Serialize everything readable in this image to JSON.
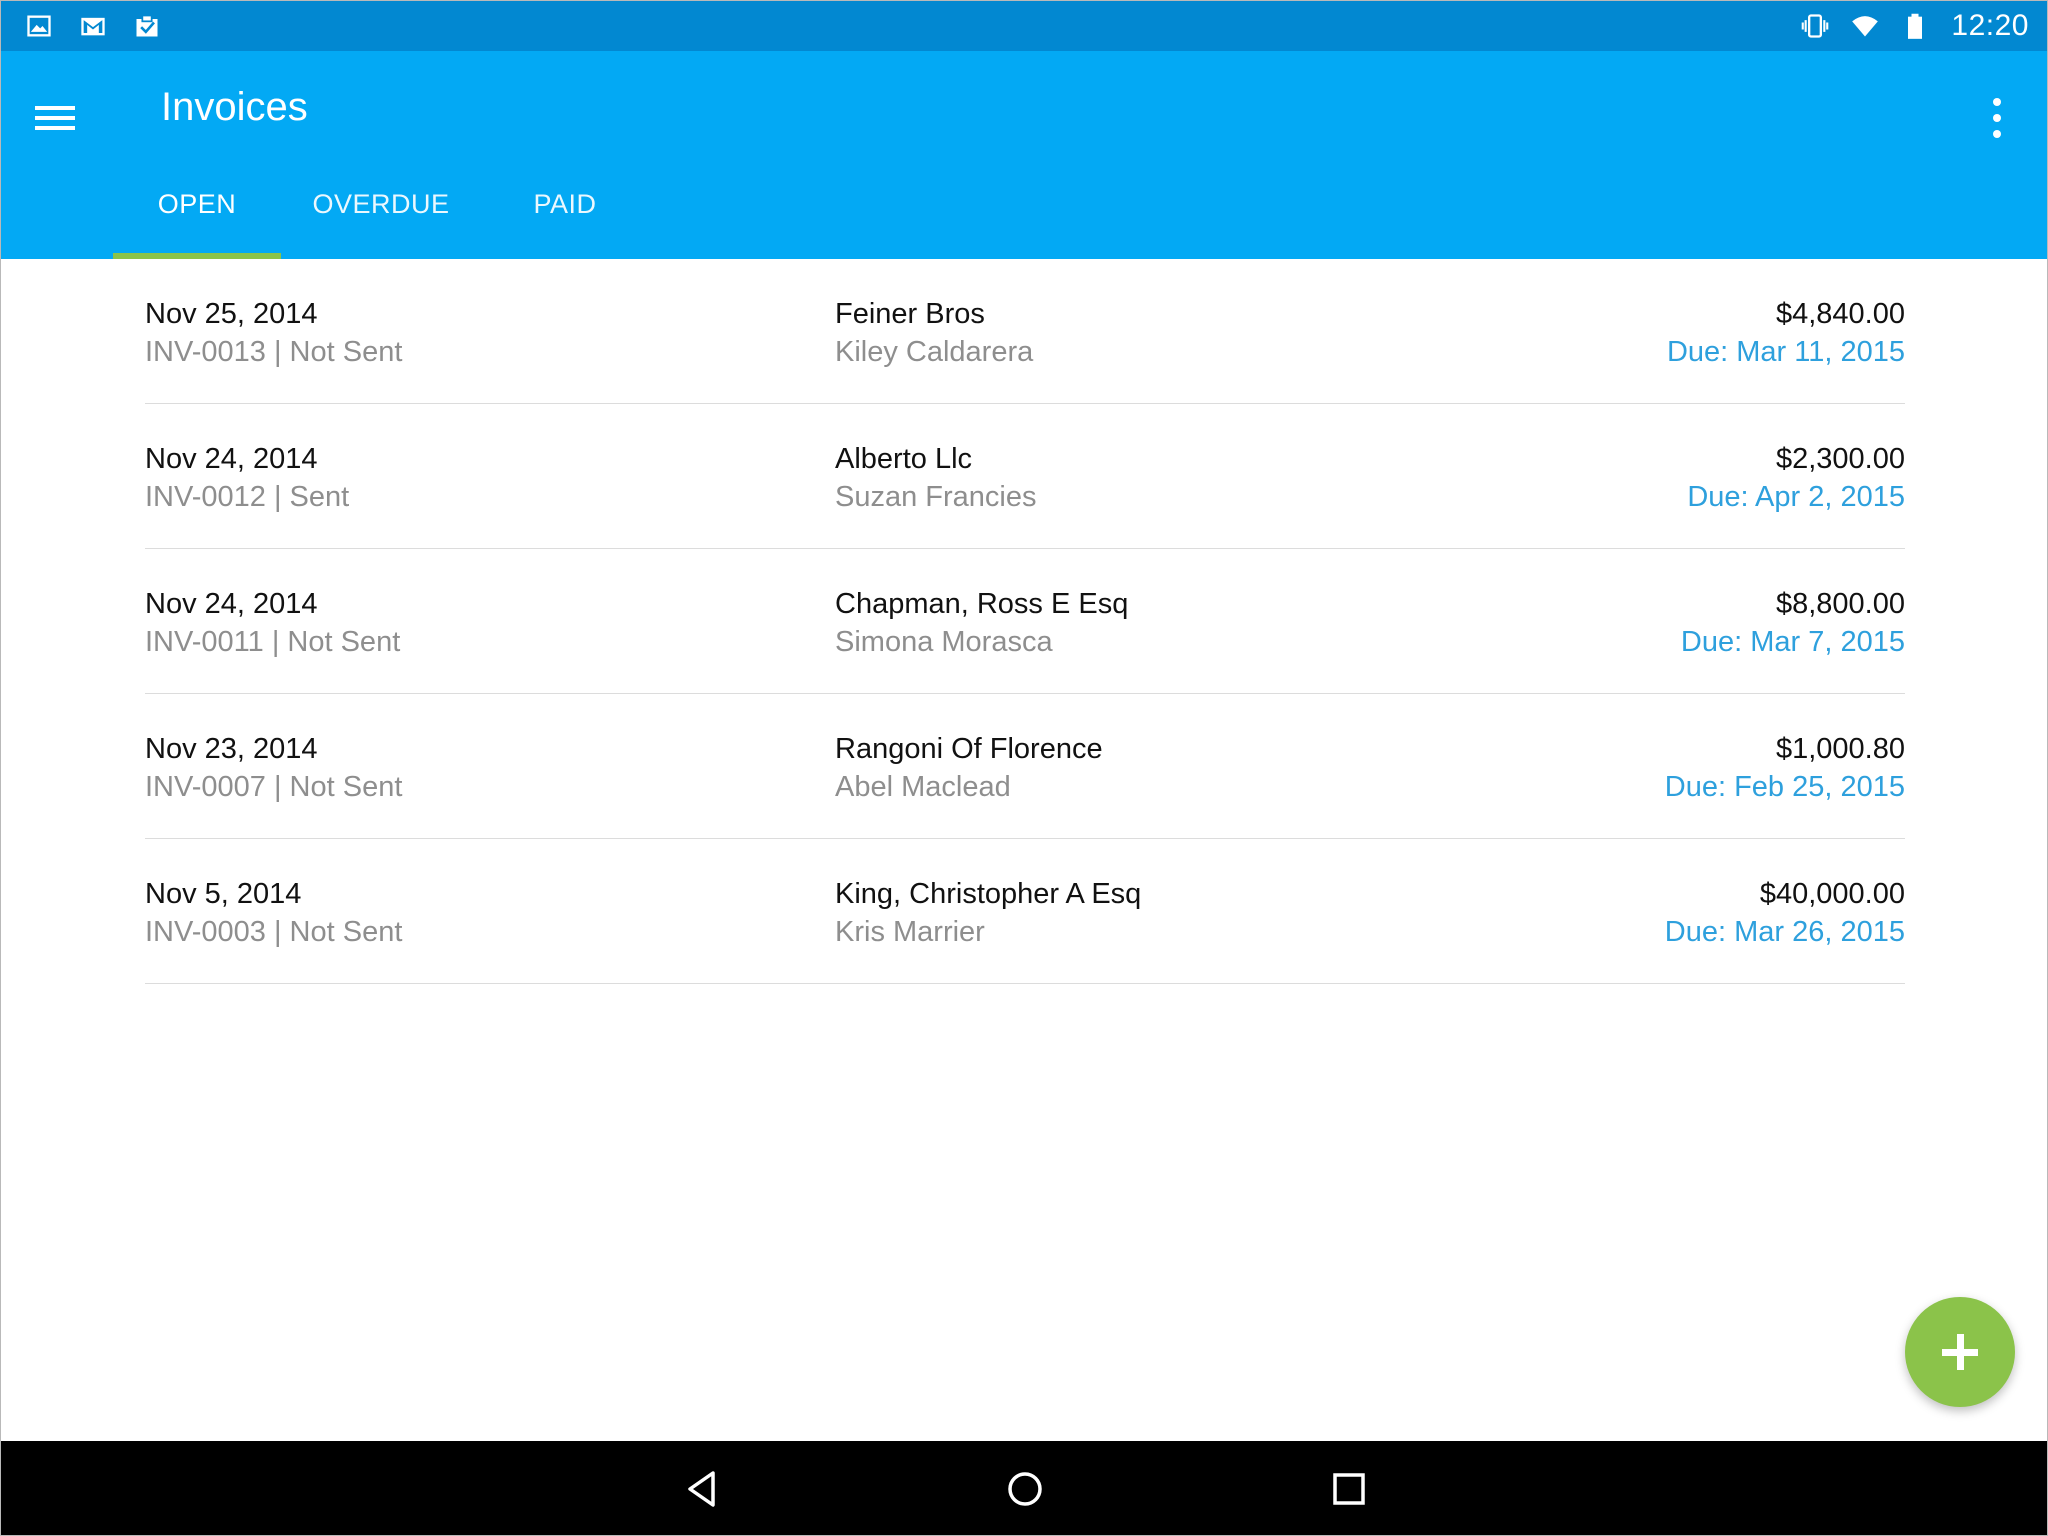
{
  "status_bar": {
    "time": "12:20",
    "left_icons": [
      "image-icon",
      "gmail-icon",
      "clipboard-check-icon"
    ],
    "right_icons": [
      "vibrate-icon",
      "wifi-icon",
      "battery-icon"
    ]
  },
  "app_bar": {
    "title": "Invoices",
    "background": "#03a9f4",
    "status_background": "#0288d1"
  },
  "tabs": [
    {
      "label": "OPEN",
      "active": true
    },
    {
      "label": "OVERDUE",
      "active": false
    },
    {
      "label": "PAID",
      "active": false
    }
  ],
  "accent": "#8bc34a",
  "due_color": "#2ea0dd",
  "invoices": [
    {
      "date": "Nov 25, 2014",
      "meta": "INV-0013 | Not Sent",
      "company": "Feiner Bros",
      "contact": "Kiley Caldarera",
      "amount": "$4,840.00",
      "due": "Due: Mar 11, 2015"
    },
    {
      "date": "Nov 24, 2014",
      "meta": "INV-0012 | Sent",
      "company": "Alberto Llc",
      "contact": "Suzan Francies",
      "amount": "$2,300.00",
      "due": "Due: Apr 2, 2015"
    },
    {
      "date": "Nov 24, 2014",
      "meta": "INV-0011 | Not Sent",
      "company": "Chapman, Ross E Esq",
      "contact": "Simona Morasca",
      "amount": "$8,800.00",
      "due": "Due: Mar 7, 2015"
    },
    {
      "date": "Nov 23, 2014",
      "meta": "INV-0007 | Not Sent",
      "company": "Rangoni Of Florence",
      "contact": "Abel Maclead",
      "amount": "$1,000.80",
      "due": "Due: Feb 25, 2015"
    },
    {
      "date": "Nov 5, 2014",
      "meta": "INV-0003 | Not Sent",
      "company": "King, Christopher A Esq",
      "contact": "Kris Marrier",
      "amount": "$40,000.00",
      "due": "Due: Mar 26, 2015"
    }
  ],
  "fab_icon": "plus-icon",
  "nav_icons": [
    "back-icon",
    "home-icon",
    "recents-icon"
  ]
}
